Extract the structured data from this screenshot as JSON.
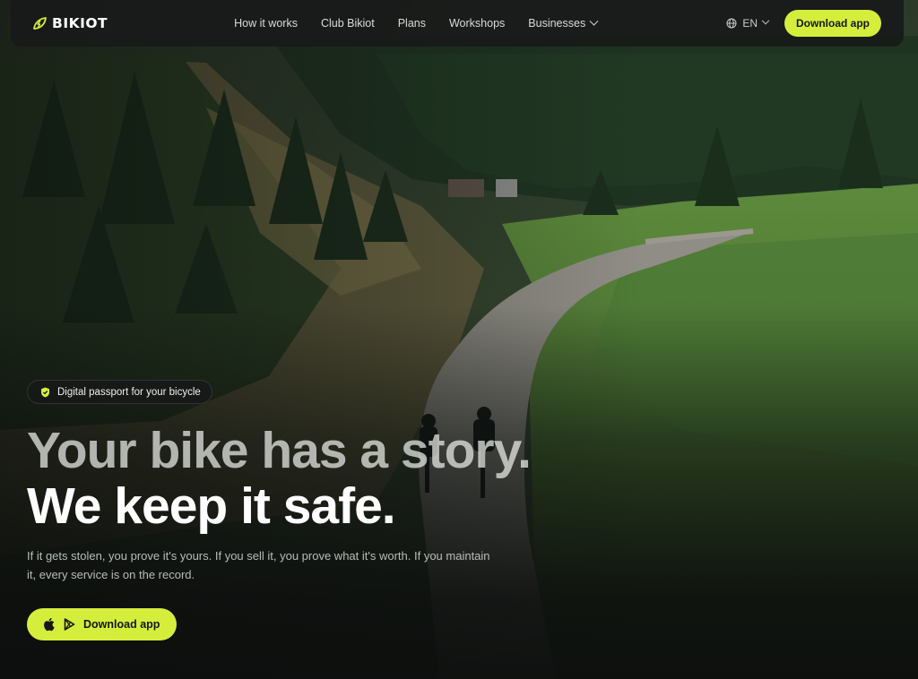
{
  "brand": {
    "name": "BIKIOT",
    "logo_icon": "leaf-bolt-icon",
    "accent_color": "#d5ee3c"
  },
  "nav": {
    "items": [
      {
        "label": "How it works"
      },
      {
        "label": "Club Bikiot"
      },
      {
        "label": "Plans"
      },
      {
        "label": "Workshops"
      },
      {
        "label": "Businesses",
        "has_dropdown": true
      }
    ],
    "language": {
      "label": "EN",
      "icon": "globe-icon"
    },
    "cta_label": "Download app"
  },
  "hero": {
    "badge": {
      "icon": "shield-check-icon",
      "label": "Digital passport for your bicycle"
    },
    "headline_line1": "Your bike has a story.",
    "headline_line2": "We keep it safe.",
    "subtitle": "If it gets stolen, you prove it's yours. If you sell it, you prove what it's worth. If you maintain it, every service is on the record.",
    "cta": {
      "label": "Download app",
      "icons": [
        "apple-icon",
        "google-play-icon"
      ]
    },
    "background": "Aerial photo of two cyclists riding a gravel road through a forested mountain valley"
  }
}
